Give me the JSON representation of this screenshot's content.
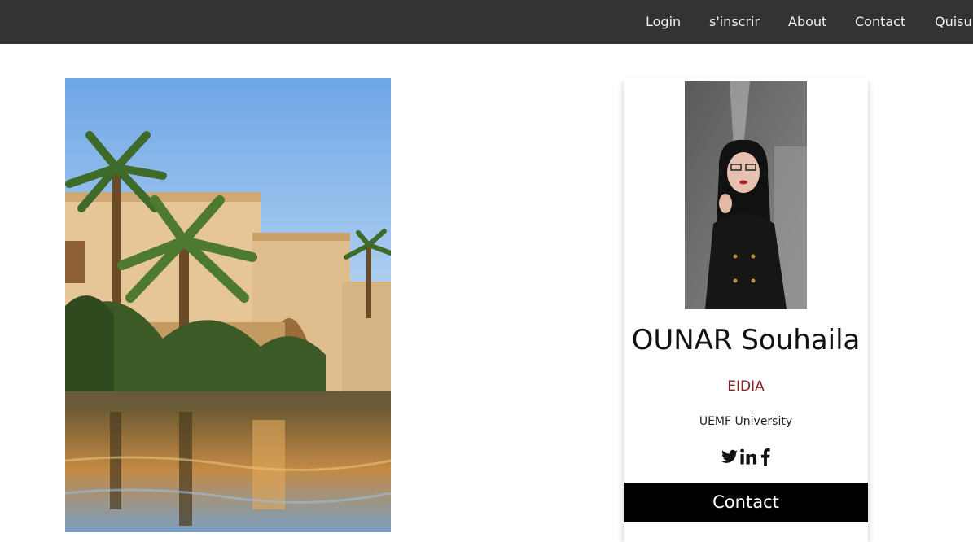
{
  "nav": {
    "items": [
      {
        "label": "Login"
      },
      {
        "label": "s'inscrir"
      },
      {
        "label": "About"
      },
      {
        "label": "Contact"
      },
      {
        "label": "Quisu"
      }
    ]
  },
  "profile": {
    "name": "OUNAR Souhaila",
    "department": "EIDIA",
    "university": "UEMF University",
    "socials": [
      "twitter-icon",
      "linkedin-icon",
      "facebook-icon"
    ],
    "contact_label": "Contact"
  },
  "colors": {
    "nav_bg": "#333333",
    "nav_text": "#f2f2f2",
    "department": "#8b1e24",
    "button_bg": "#000000"
  }
}
